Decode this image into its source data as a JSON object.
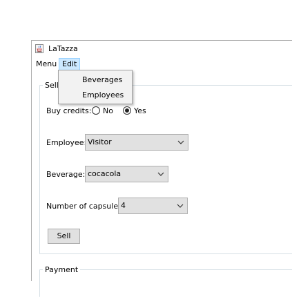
{
  "window": {
    "title": "LaTazza",
    "icon": "java-cup-icon"
  },
  "menubar": {
    "items": [
      {
        "label": "Menu"
      },
      {
        "label": "Edit"
      }
    ]
  },
  "edit_menu": {
    "items": [
      {
        "label": "Beverages"
      },
      {
        "label": "Employees"
      }
    ]
  },
  "sell_section": {
    "title": "Sell c",
    "buy_credits": {
      "label": "Buy credits:",
      "options": [
        "No",
        "Yes"
      ],
      "selected": "Yes"
    },
    "employee": {
      "label": "Employee:",
      "value": "Visitor"
    },
    "beverage": {
      "label": "Beverage:",
      "value": "cocacola"
    },
    "capsules": {
      "label": "Number of capsules:",
      "value": "4"
    },
    "sell_button": "Sell"
  },
  "payment_section": {
    "title": "Payment"
  }
}
